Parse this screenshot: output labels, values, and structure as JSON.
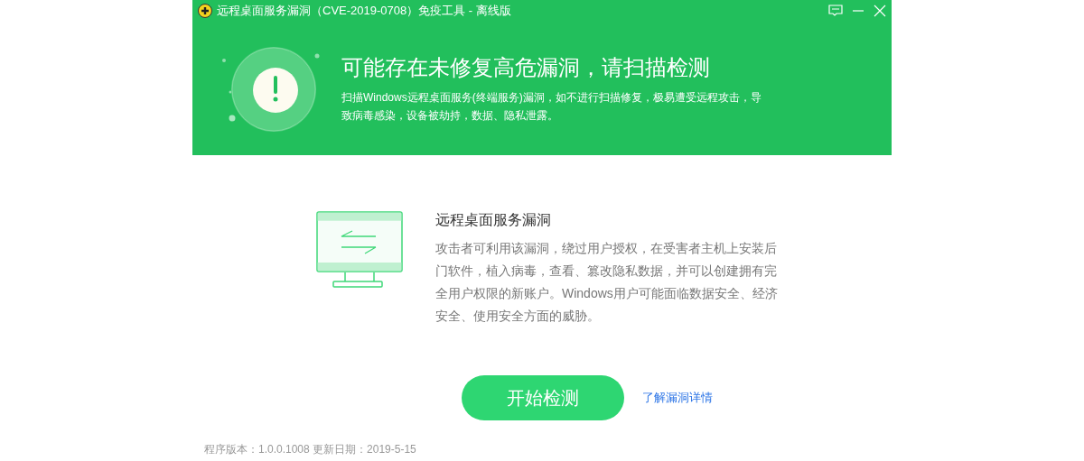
{
  "window": {
    "title": "远程桌面服务漏洞（CVE-2019-0708）免疫工具 - 离线版"
  },
  "header": {
    "headline": "可能存在未修复高危漏洞，请扫描检测",
    "description": "扫描Windows远程桌面服务(终端服务)漏洞，如不进行扫描修复，极易遭受远程攻击，导致病毒感染，设备被劫持，数据、隐私泄露。"
  },
  "vulnerability": {
    "title": "远程桌面服务漏洞",
    "description": "攻击者可利用该漏洞，绕过用户授权，在受害者主机上安装后门软件，植入病毒，查看、篡改隐私数据，并可以创建拥有完全用户权限的新账户。Windows用户可能面临数据安全、经济安全、使用安全方面的威胁。"
  },
  "start_button": "开始检测",
  "details_link": "了解漏洞详情",
  "footer": "程序版本：1.0.0.1008 更新日期：2019-5-15"
}
